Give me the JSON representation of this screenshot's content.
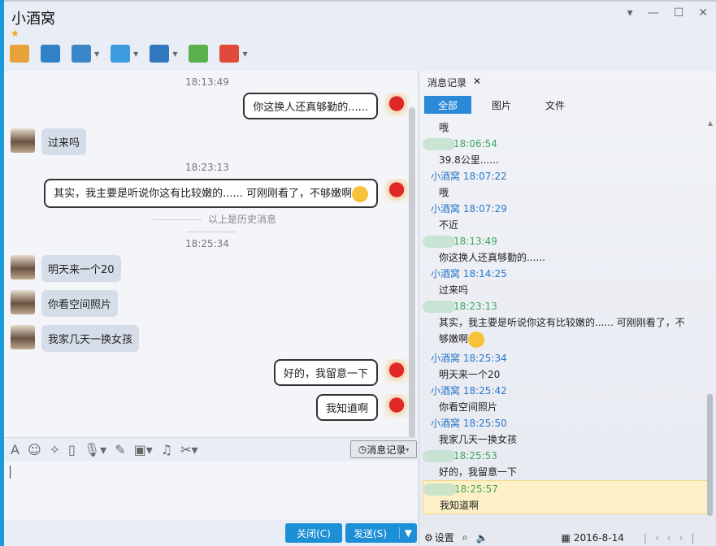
{
  "window": {
    "title": "小酒窝",
    "controls": [
      "▾",
      "—",
      "☐",
      "✕"
    ]
  },
  "toolbar": [
    {
      "name": "voice-icon",
      "color": "#e8a23a"
    },
    {
      "name": "video-icon",
      "color": "#2f82c8"
    },
    {
      "name": "screen-share-icon",
      "color": "#3a86c8",
      "menu": true
    },
    {
      "name": "file-transfer-icon",
      "color": "#3d9be0",
      "menu": true
    },
    {
      "name": "remote-desktop-icon",
      "color": "#2f78c0",
      "menu": true
    },
    {
      "name": "new-chat-icon",
      "color": "#5ab04a"
    },
    {
      "name": "apps-icon",
      "color": "#e04a3a",
      "menu": true
    }
  ],
  "chat": {
    "timestamps": [
      "18:13:49",
      "18:23:13",
      "18:25:34"
    ],
    "divider": "以上是历史消息",
    "messages": [
      "你这换人还真够勤的......",
      "过来吗",
      "其实，我主要是听说你这有比较嫩的...... 可刚刚看了，不够嫩啊",
      "明天来一个20",
      "你看空间照片",
      "我家几天一换女孩",
      "好的，我留意一下",
      "我知道啊"
    ]
  },
  "input": {
    "history_button": "消息记录",
    "close_button": "关闭(C)",
    "send_button": "发送(S)"
  },
  "history": {
    "tab": "消息记录",
    "filters": [
      "全部",
      "图片",
      "文件"
    ],
    "records": [
      {
        "text": "哦"
      },
      {
        "self": true,
        "time": "18:06:54",
        "text": "39.8公里......"
      },
      {
        "sender": "小酒窝",
        "time": "18:07:22",
        "text": "哦"
      },
      {
        "sender": "小酒窝",
        "time": "18:07:29",
        "text": "不近"
      },
      {
        "self": true,
        "time": "18:13:49",
        "text": "你这换人还真够勤的......"
      },
      {
        "sender": "小酒窝",
        "time": "18:14:25",
        "text": "过来吗"
      },
      {
        "self": true,
        "time": "18:23:13",
        "text": "其实，我主要是听说你这有比较嫩的...... 可刚刚看了，不",
        "text2": "够嫩啊"
      },
      {
        "sender": "小酒窝",
        "time": "18:25:34",
        "text": "明天来一个20"
      },
      {
        "sender": "小酒窝",
        "time": "18:25:42",
        "text": "你看空间照片"
      },
      {
        "sender": "小酒窝",
        "time": "18:25:50",
        "text": "我家几天一换女孩"
      },
      {
        "self": true,
        "time": "18:25:53",
        "text": "好的，我留意一下"
      },
      {
        "self": true,
        "time": "18:25:57",
        "text": "我知道啊",
        "highlight": true
      }
    ],
    "settings": "设置",
    "date": "2016-8-14"
  }
}
